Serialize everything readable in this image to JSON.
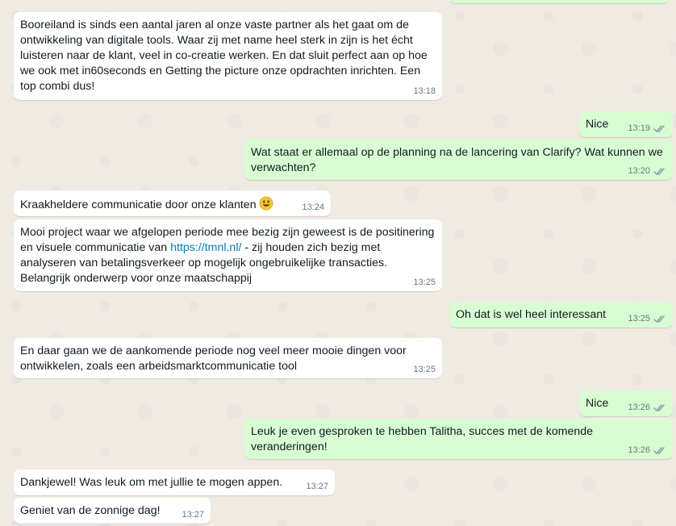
{
  "messages": [
    {
      "dir": "in",
      "text": "Booreiland is sinds een aantal jaren al onze vaste partner als het gaat om de ontwikkeling van digitale tools. Waar zij met name heel sterk in zijn is het écht luisteren naar de klant, veel in co-creatie werken. En dat sluit perfect aan op hoe we ook met in60seconds en Getting the picture onze opdrachten inrichten. Een top combi dus!",
      "time": "13:18"
    },
    {
      "dir": "out",
      "text": "Nice",
      "time": "13:19"
    },
    {
      "dir": "out",
      "text": "Wat staat er allemaal op de planning na de lancering van Clarify? Wat kunnen we verwachten?",
      "time": "13:20"
    },
    {
      "dir": "in",
      "text": "Kraakheldere communicatie door onze klanten",
      "emoji": "smiley-face-icon",
      "time": "13:24"
    },
    {
      "dir": "in",
      "text_before_link": "Mooi project waar we afgelopen periode mee bezig zijn geweest is de positinering en visuele communicatie van ",
      "link": "https://tmnl.nl/",
      "text_after_link": " - zij houden zich bezig met analyseren van betalingsverkeer op mogelijk ongebruikelijke transacties. Belangrijk onderwerp voor onze maatschappij",
      "time": "13:25"
    },
    {
      "dir": "out",
      "text": "Oh dat is wel heel interessant",
      "time": "13:25"
    },
    {
      "dir": "in",
      "text": "En daar gaan we de aankomende periode nog veel meer mooie dingen voor ontwikkelen, zoals een arbeidsmarktcommunicatie tool",
      "time": "13:25"
    },
    {
      "dir": "out",
      "text": "Nice",
      "time": "13:26"
    },
    {
      "dir": "out",
      "text": "Leuk je even gesproken te hebben Talitha, succes met de komende veranderingen!",
      "time": "13:26"
    },
    {
      "dir": "in",
      "text": "Dankjewel! Was leuk om met jullie te mogen appen.",
      "time": "13:27"
    },
    {
      "dir": "in",
      "text": "Geniet van de zonnige dag!",
      "time": "13:27"
    }
  ],
  "colors": {
    "incoming_bubble": "#ffffff",
    "outgoing_bubble": "#d9fdd3",
    "timestamp": "#667781",
    "link": "#027eb5",
    "read_ticks": "#8696a0"
  }
}
